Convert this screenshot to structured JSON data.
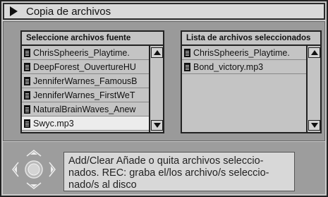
{
  "header": {
    "title": "Copia de archivos"
  },
  "source_panel": {
    "title": "Seleccione archivos fuente",
    "items": [
      "ChrisSpheeris_Playtime.",
      "DeepForest_OuvertureHU",
      "JenniferWarnes_FamousB",
      "JenniferWarnes_FirstWeT",
      "NaturalBrainWaves_Anew",
      "Swyc.mp3"
    ],
    "selected_item": "Swyc.mp3"
  },
  "selected_panel": {
    "title": "Lista de archivos seleccionados",
    "items": [
      "ChrisSpheeris_Playtime.",
      "Bond_victory.mp3"
    ]
  },
  "help": {
    "text": "Add/Clear  Añade o quita archivos seleccio-nados. REC: graba el/los archivo/s seleccio-nado/s al disco"
  },
  "colors": {
    "background": "#c9c9c9",
    "main_area": "#9a9a9a",
    "panel": "#c4c4c4",
    "selected_row": "#ececec"
  }
}
